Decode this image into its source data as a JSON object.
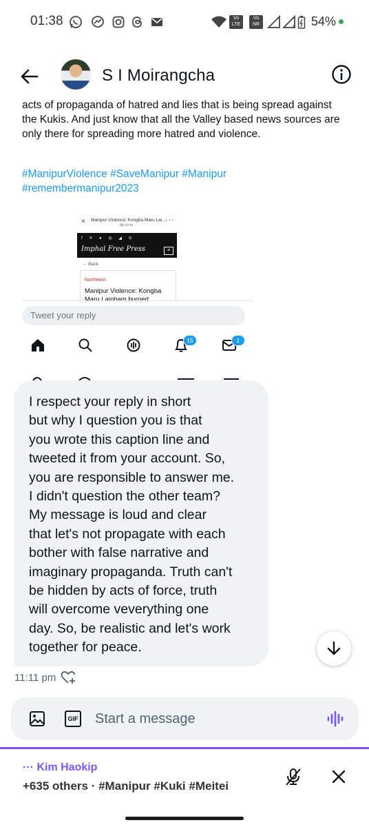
{
  "status_bar": {
    "time": "01:38",
    "battery": "54%",
    "battery_dot_color": "#3aa655",
    "app_icons": [
      "whatsapp-icon",
      "messenger-icon",
      "instagram-icon",
      "threads-icon",
      "gmail-icon"
    ],
    "right_icons": [
      "wifi-icon",
      "volte-icon",
      "signal-icon",
      "battery-icon"
    ],
    "volte_1": "Vo LTE",
    "volte_2": "Vo NR"
  },
  "header": {
    "contact_name": "S I Moirangcha"
  },
  "shared_image": {
    "tweet_text": "acts of propaganda of hatred and lies that is being spread against the Kukis. And just know that all the Valley based news sources are only there for spreading more hatred and violence.",
    "hashtags": "#ManipurViolence #SaveManipur #Manipur #remembermanipur2023",
    "thumbnail": {
      "title": "Manipur Violence: Kongba Maru Laipham...",
      "domain": "ifp.co.in",
      "masthead": "Imphal Free Press",
      "back": "← Back",
      "category": "Northeast",
      "headline": "Manipur Violence: Kongba Maru Laipham burned"
    },
    "reply_placeholder": "Tweet your reply",
    "nav_badges": {
      "notifications": "15",
      "messages": "1"
    }
  },
  "message": {
    "text": "I respect your reply in short\nbut why I question you is that\nyou wrote this caption line and\ntweeted it from your account. So,\nyou are responsible to answer me.\nI didn't question the other team?\nMy message is loud and clear\nthat let's not propagate with each\nbother with false narrative and\nimaginary propaganda. Truth can't\nbe hidden by acts of force, truth\nwill overcome veverything one\nday.  So, be realistic and let's work\ntogether for peace.",
    "time": "11:11 pm"
  },
  "composer": {
    "placeholder": "Start a message",
    "gif_label": "GIF"
  },
  "space": {
    "host": "Kim Haokip",
    "listeners": "+635 others · #Manipur #Kuki #Meitei",
    "accent": "#7856ff"
  },
  "colors": {
    "bubble": "#eff3f4",
    "link": "#1d9bf0",
    "text": "#0f1419",
    "muted": "#536471"
  }
}
